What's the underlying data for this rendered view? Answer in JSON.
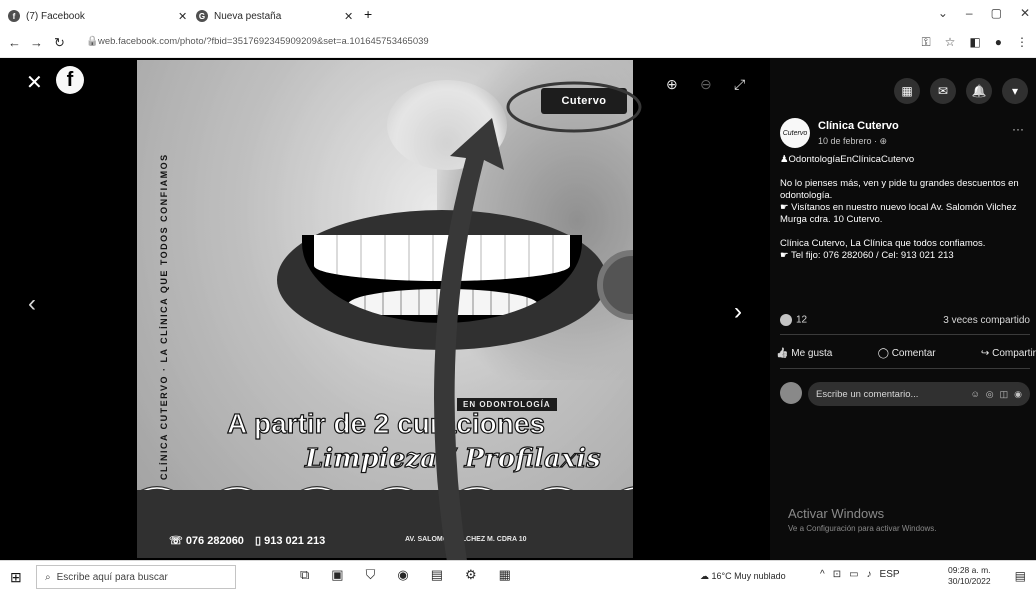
{
  "browser": {
    "tabs": [
      {
        "label": "(7) Facebook",
        "icon": "facebook-icon"
      },
      {
        "label": "Nueva pestaña",
        "icon": "chrome-icon"
      }
    ],
    "url": "web.facebook.com/photo/?fbid=3517692345909209&set=a.101645753465039"
  },
  "poster": {
    "vertical_tagline": "CLÍNICA CUTERVO · LA CLÍNICA QUE TODOS CONFIAMOS",
    "logo": "Cutervo",
    "promo_tag": "EN ODONTOLOGÍA",
    "promo_main": "A partir de 2 curaciones",
    "promo_sub": "Limpieza / Profilaxis",
    "phone1": "076 282060",
    "phone2": "913 021 213",
    "address": "AV. SALOMÓN VILCHEZ M. CDRA 10"
  },
  "post": {
    "page_name": "Clínica Cutervo",
    "date": "10 de febrero · ",
    "hashtag": "OdontologíaEnClínicaCutervo",
    "paragraph1": "No lo pienses más, ven y pide tu grandes descuentos en odontología.",
    "paragraph1b": "Visítanos en nuestro nuevo local Av. Salomón Vilchez Murga cdra. 10 Cutervo.",
    "paragraph2": "Clínica Cutervo, La Clínica que todos confiamos.",
    "paragraph2b": "Tel fijo: 076 282060 / Cel: 913 021 213",
    "reaction_count": "12",
    "shares": "3 veces compartido",
    "like_label": "Me gusta",
    "comment_label": "Comentar",
    "share_label": "Compartir",
    "comment_placeholder": "Escribe un comentario..."
  },
  "windows": {
    "activate_title": "Activar Windows",
    "activate_sub": "Ve a Configuración para activar Windows."
  },
  "taskbar": {
    "search_placeholder": "Escribe aquí para buscar",
    "weather": "16°C Muy nublado",
    "language": "ESP",
    "time": "09:28 a. m.",
    "date": "30/10/2022"
  },
  "colors": {
    "annotation": "#e8141b",
    "panel_bg": "#1a1a1a"
  }
}
